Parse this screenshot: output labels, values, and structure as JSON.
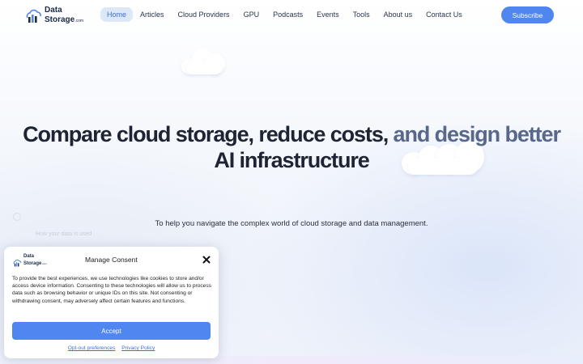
{
  "brand": {
    "line1": "Data",
    "line2": "Storage",
    "suffix": ".com"
  },
  "nav": {
    "items": [
      {
        "label": "Home",
        "active": true
      },
      {
        "label": "Articles"
      },
      {
        "label": "Cloud Providers"
      },
      {
        "label": "GPU"
      },
      {
        "label": "Podcasts"
      },
      {
        "label": "Events"
      },
      {
        "label": "Tools"
      },
      {
        "label": "About us"
      },
      {
        "label": "Contact Us"
      }
    ],
    "subscribe_label": "Subscribe"
  },
  "hero": {
    "title_dark": "Compare cloud storage, reduce costs,",
    "title_accent": "and design better",
    "title_line2": "AI infrastructure",
    "subtitle": "To help you navigate the complex world of cloud storage and data management."
  },
  "background_hint": {
    "placeholder": "How your data is used"
  },
  "consent": {
    "title": "Manage Consent",
    "body": "To provide the best experiences, we use technologies like cookies to store and/or access device information. Consenting to these technologies will allow us to process data such as browsing behavior or unique IDs on this site. Not consenting or withdrawing consent, may adversely affect certain features and functions.",
    "accept_label": "Accept",
    "links": [
      "Opt-out preferences",
      "Privacy Policy"
    ]
  },
  "colors": {
    "accent": "#4f86ef",
    "active_nav_bg": "#dce7f8",
    "heading": "#1e2433"
  },
  "icons": {
    "brand": "cloud-bars-icon",
    "close": "close-icon"
  }
}
